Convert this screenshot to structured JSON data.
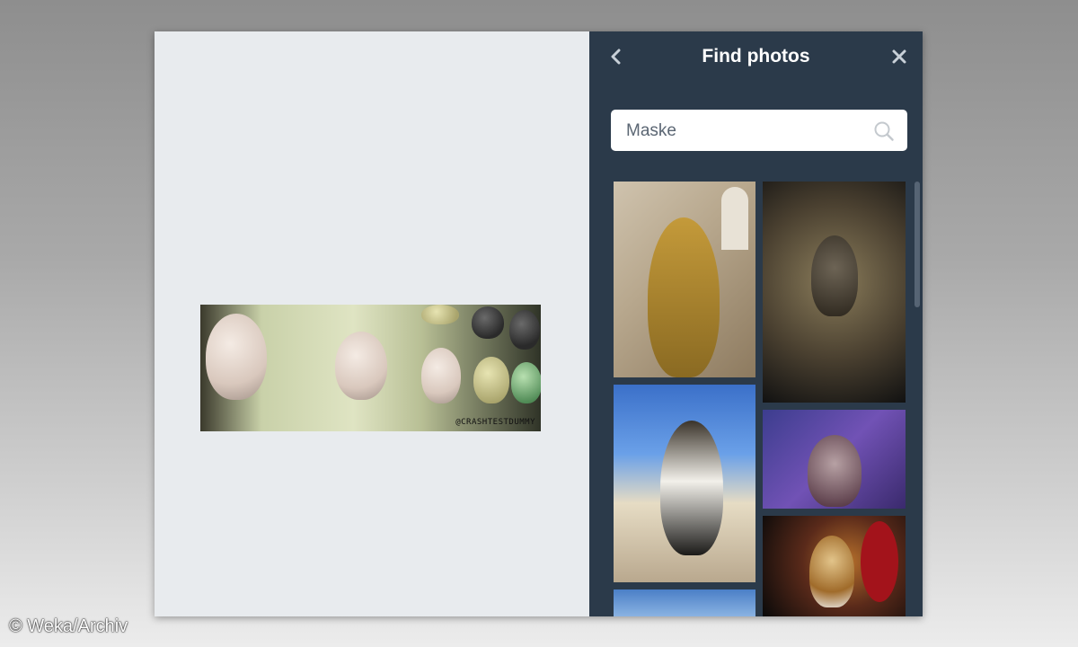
{
  "panel": {
    "title": "Find photos",
    "back_icon": "chevron-left-icon",
    "close_icon": "close-icon"
  },
  "search": {
    "value": "Maske",
    "placeholder": "",
    "icon": "search-icon"
  },
  "canvas_image": {
    "watermark": "@CRASHTESTDUMMY"
  },
  "results": [
    {
      "name": "photo-golden-statue"
    },
    {
      "name": "photo-gas-mask"
    },
    {
      "name": "photo-seabird"
    },
    {
      "name": "photo-horned-mask"
    },
    {
      "name": "photo-venetian-mask"
    },
    {
      "name": "photo-partial"
    }
  ],
  "credit": "© Weka/Archiv",
  "colors": {
    "panel_bg": "#2b3a4a",
    "canvas_bg": "#e8ebee",
    "title_text": "#ffffff"
  }
}
